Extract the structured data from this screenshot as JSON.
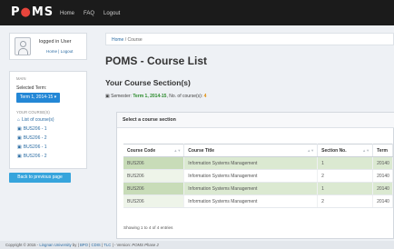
{
  "header": {
    "brand_prefix": "P",
    "brand_o": "●",
    "brand_suffix": "MS",
    "nav": [
      "Home",
      "FAQ",
      "Logout"
    ]
  },
  "sidebar": {
    "user_name": "logged in User",
    "user_links": "Home | Logout",
    "main_heading": "MAIN",
    "selected_term_label": "Selected Term:",
    "term_button": "Term 1, 2014-15 ▾",
    "courses_heading": "YOUR COURSE(S)",
    "links": [
      {
        "icon": "home-icon",
        "glyph": "⌂",
        "label": "List of course(s)"
      },
      {
        "icon": "book-icon",
        "glyph": "▣",
        "label": "BUS206 - 1"
      },
      {
        "icon": "book-icon",
        "glyph": "▣",
        "label": "BUS206 - 2"
      },
      {
        "icon": "book-icon",
        "glyph": "▣",
        "label": "BUS206 - 1"
      },
      {
        "icon": "book-icon",
        "glyph": "▣",
        "label": "BUS206 - 2"
      }
    ],
    "back_button": "Back to previous page"
  },
  "main": {
    "breadcrumb_home": "Home",
    "breadcrumb_sep": " / ",
    "breadcrumb_current": "Course",
    "page_title": "POMS - Course List",
    "section_heading": "Your Course Section(s)",
    "semester_prefix": "Semester: ",
    "semester_term": "Term 1, 2014-15",
    "semester_mid": ", No. of course(s): ",
    "semester_count": "4",
    "panel_title": "Select a course section",
    "table": {
      "headers": [
        "Course Code",
        "Course Title",
        "Section No.",
        "Term"
      ],
      "rows": [
        [
          "BUS206",
          "Information Systems Management",
          "1",
          "20140"
        ],
        [
          "BUS206",
          "Information Systems Management",
          "2",
          "20140"
        ],
        [
          "BUS206",
          "Information Systems Management",
          "1",
          "20140"
        ],
        [
          "BUS206",
          "Information Systems Management",
          "2",
          "20140"
        ]
      ]
    },
    "entries_info": "Showing 1 to 4 of 4 entries"
  },
  "footer": {
    "copyright": "Copyright © 2015 - ",
    "org": "Lingnan University",
    "by": " by ",
    "links": [
      "BPO",
      "CDIS",
      "TLC"
    ],
    "sep": " | ",
    "version_label": " - Version: ",
    "version": "POMS Phase 2"
  },
  "colors": {
    "topbar": "#1b1b1b",
    "accent": "#2387d6",
    "link": "#2b6ca3",
    "row_highlight": "#dbe9d1"
  }
}
